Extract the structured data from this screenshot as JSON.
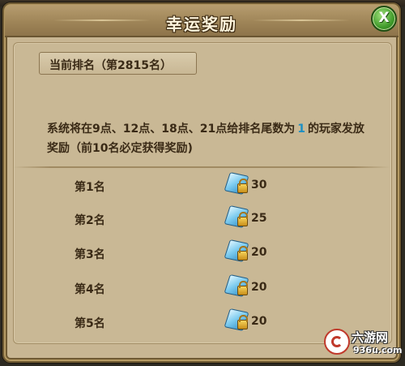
{
  "dialog": {
    "title": "幸运奖励",
    "close_label": "X"
  },
  "rank_tab": {
    "label": "当前排名（第2815名）"
  },
  "description": {
    "before": "系统将在9点、12点、18点、21点给排名尾数为",
    "highlight": "1",
    "after": "的玩家发放奖励（前10名必定获得奖励)",
    "highlight_color": "#1d8fc3"
  },
  "rewards": [
    {
      "rank_label": "第1名",
      "icon": "diamond-lock-icon",
      "amount": "30"
    },
    {
      "rank_label": "第2名",
      "icon": "diamond-lock-icon",
      "amount": "25"
    },
    {
      "rank_label": "第3名",
      "icon": "diamond-lock-icon",
      "amount": "20"
    },
    {
      "rank_label": "第4名",
      "icon": "diamond-lock-icon",
      "amount": "20"
    },
    {
      "rank_label": "第5名",
      "icon": "diamond-lock-icon",
      "amount": "20"
    }
  ],
  "watermark": {
    "name": "六游网",
    "url": "936u.com"
  },
  "colors": {
    "panel_bg": "#c9b895",
    "header_bg": "#9f8558",
    "text": "#3a2a16",
    "close_button": "#3f9a2a"
  }
}
